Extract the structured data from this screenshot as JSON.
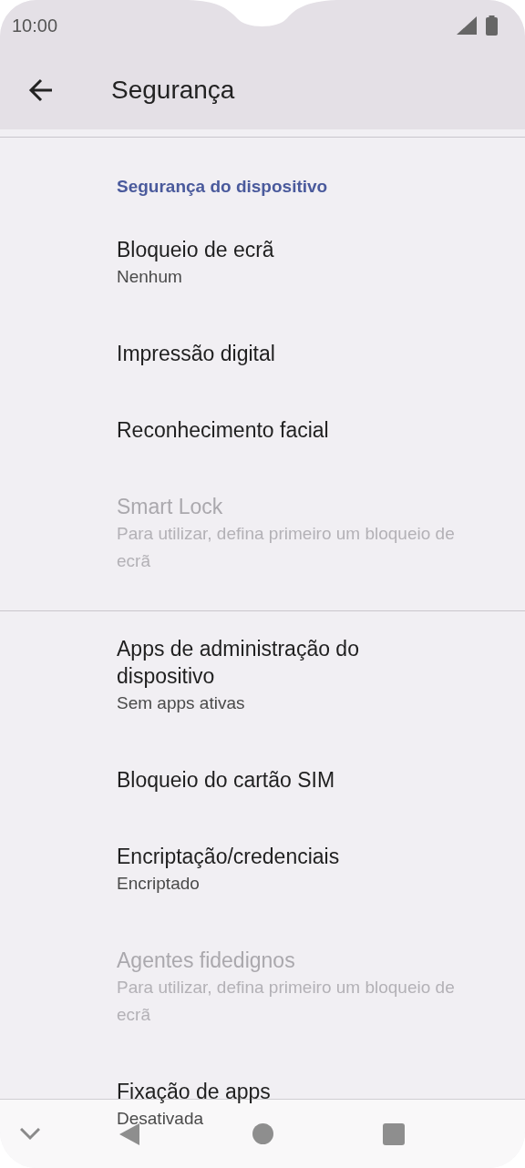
{
  "status_bar": {
    "time": "10:00"
  },
  "app_bar": {
    "title": "Segurança"
  },
  "sections": [
    {
      "header": "Segurança do dispositivo",
      "items": [
        {
          "title": "Bloqueio de ecrã",
          "summary": "Nenhum",
          "disabled": false
        },
        {
          "title": "Impressão digital",
          "disabled": false
        },
        {
          "title": "Reconhecimento facial",
          "disabled": false
        },
        {
          "title": "Smart Lock",
          "summary": "Para utilizar, defina primeiro um bloqueio de ecrã",
          "disabled": true
        }
      ]
    },
    {
      "items": [
        {
          "title": "Apps de administração do dispositivo",
          "summary": "Sem apps ativas",
          "disabled": false
        },
        {
          "title": "Bloqueio do cartão SIM",
          "disabled": false
        },
        {
          "title": "Encriptação/credenciais",
          "summary": "Encriptado",
          "disabled": false
        },
        {
          "title": "Agentes fidedignos",
          "summary": "Para utilizar, defina primeiro um bloqueio de ecrã",
          "disabled": true
        },
        {
          "title": "Fixação de apps",
          "summary": "Desativada",
          "disabled": false
        }
      ]
    }
  ]
}
